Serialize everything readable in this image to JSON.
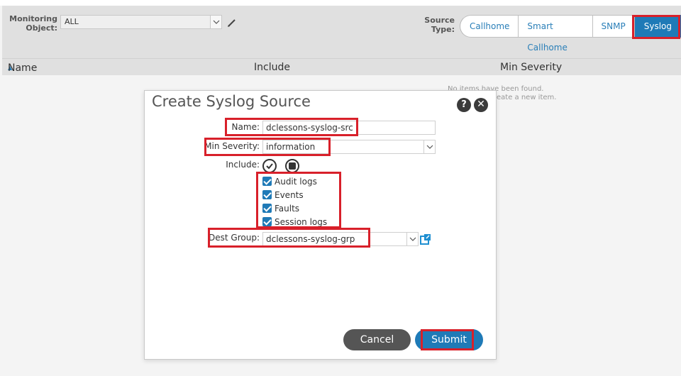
{
  "toolbar": {
    "monitoring_object_label_1": "Monitoring",
    "monitoring_object_label_2": "Object:",
    "monitoring_object_value": "ALL",
    "source_type_label_1": "Source",
    "source_type_label_2": "Type:",
    "source_types": [
      "Callhome",
      "Smart Callhome",
      "SNMP",
      "Syslog"
    ],
    "selected_source_type": "Syslog"
  },
  "table": {
    "columns": [
      "Name",
      "Include",
      "Min Severity"
    ],
    "empty_text_1": "No items have been found.",
    "empty_text_2": "eate a new item."
  },
  "dialog": {
    "title": "Create Syslog Source",
    "name_label": "Name:",
    "name_value": "dclessons-syslog-src",
    "min_severity_label": "Min Severity:",
    "min_severity_value": "information",
    "include_label": "Include:",
    "include_options": [
      "Audit logs",
      "Events",
      "Faults",
      "Session logs"
    ],
    "dest_group_label": "Dest Group:",
    "dest_group_value": "dclessons-syslog-grp",
    "cancel_label": "Cancel",
    "submit_label": "Submit"
  },
  "colors": {
    "accent": "#1f7ab7",
    "highlight": "#d8202a",
    "cancel_button": "#555555"
  }
}
